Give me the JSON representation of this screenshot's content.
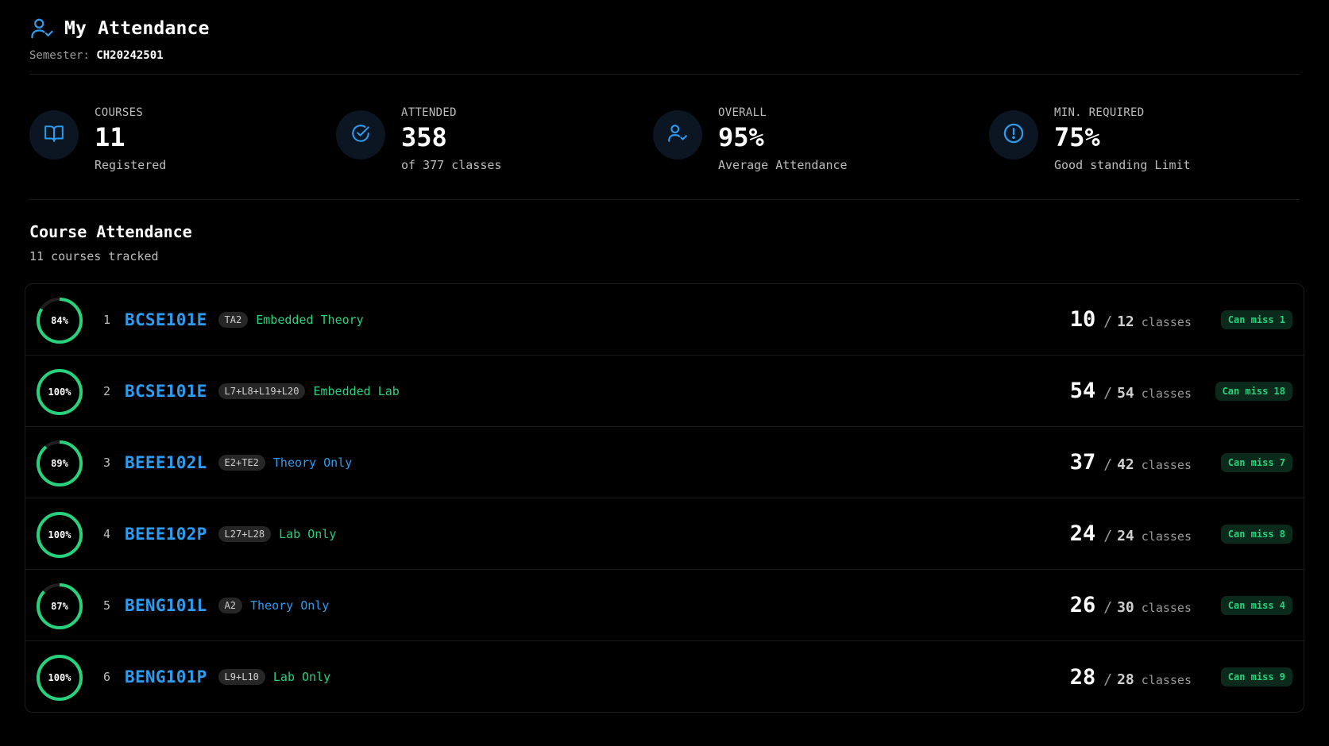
{
  "header": {
    "title": "My Attendance",
    "semester_label": "Semester:",
    "semester_value": "CH20242501"
  },
  "stats": [
    {
      "label": "COURSES",
      "value": "11",
      "sub": "Registered",
      "icon": "book-icon"
    },
    {
      "label": "ATTENDED",
      "value": "358",
      "sub": "of 377 classes",
      "icon": "check-circle-icon"
    },
    {
      "label": "OVERALL",
      "value": "95%",
      "sub": "Average Attendance",
      "icon": "user-check-icon"
    },
    {
      "label": "MIN. REQUIRED",
      "value": "75%",
      "sub": "Good standing Limit",
      "icon": "alert-circle-icon"
    }
  ],
  "section": {
    "title": "Course Attendance",
    "subtitle": "11 courses tracked"
  },
  "courses": [
    {
      "index": "1",
      "percent_label": "84%",
      "percent": 84,
      "code": "BCSE101E",
      "slot": "TA2",
      "type": "Embedded Theory",
      "type_color": "green",
      "attended": "10",
      "total": "12",
      "unit": "classes",
      "badge": "Can miss 1"
    },
    {
      "index": "2",
      "percent_label": "100%",
      "percent": 100,
      "code": "BCSE101E",
      "slot": "L7+L8+L19+L20",
      "type": "Embedded Lab",
      "type_color": "green",
      "attended": "54",
      "total": "54",
      "unit": "classes",
      "badge": "Can miss 18"
    },
    {
      "index": "3",
      "percent_label": "89%",
      "percent": 89,
      "code": "BEEE102L",
      "slot": "E2+TE2",
      "type": "Theory Only",
      "type_color": "blue",
      "attended": "37",
      "total": "42",
      "unit": "classes",
      "badge": "Can miss 7"
    },
    {
      "index": "4",
      "percent_label": "100%",
      "percent": 100,
      "code": "BEEE102P",
      "slot": "L27+L28",
      "type": "Lab Only",
      "type_color": "green",
      "attended": "24",
      "total": "24",
      "unit": "classes",
      "badge": "Can miss 8"
    },
    {
      "index": "5",
      "percent_label": "87%",
      "percent": 87,
      "code": "BENG101L",
      "slot": "A2",
      "type": "Theory Only",
      "type_color": "blue",
      "attended": "26",
      "total": "30",
      "unit": "classes",
      "badge": "Can miss 4"
    },
    {
      "index": "6",
      "percent_label": "100%",
      "percent": 100,
      "code": "BENG101P",
      "slot": "L9+L10",
      "type": "Lab Only",
      "type_color": "green",
      "attended": "28",
      "total": "28",
      "unit": "classes",
      "badge": "Can miss 9"
    }
  ],
  "colors": {
    "accent_blue": "#2d9cf0",
    "accent_green": "#28d17c",
    "ring_track": "#1f1f1f"
  }
}
